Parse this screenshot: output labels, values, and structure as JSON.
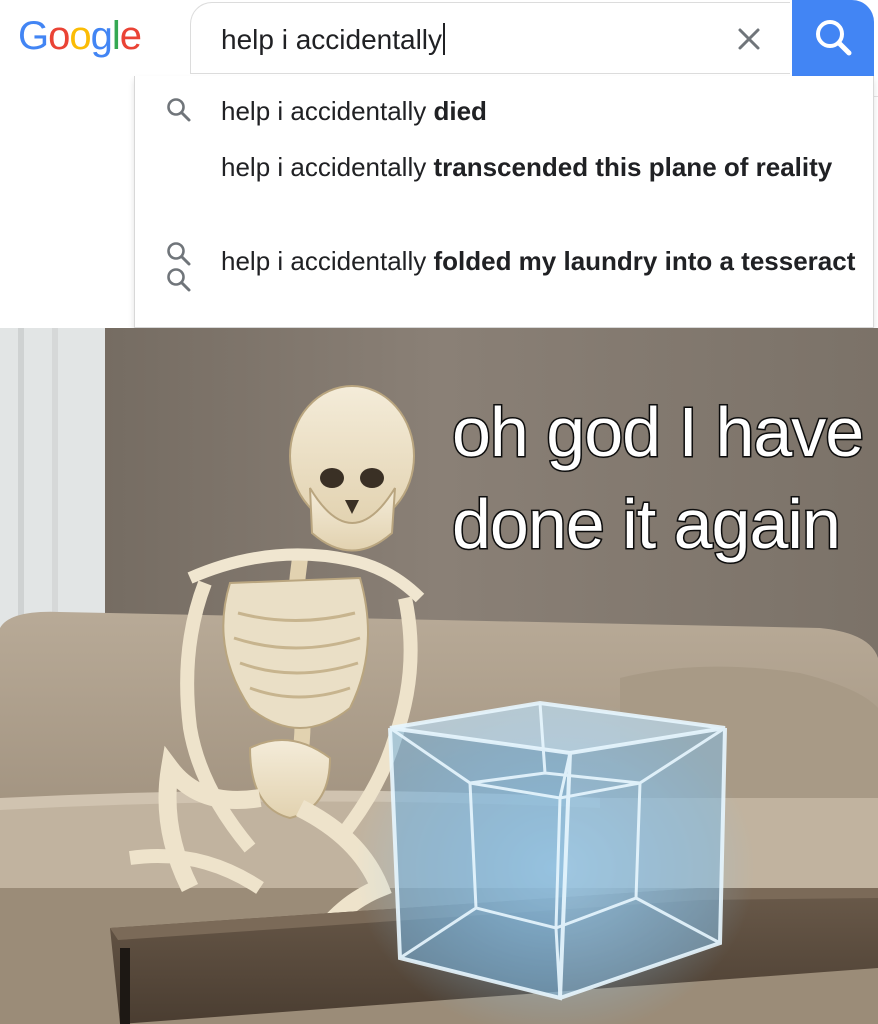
{
  "header": {
    "logo": {
      "letters": [
        "G",
        "o",
        "o",
        "g",
        "l",
        "e"
      ],
      "colors": [
        "#4285f4",
        "#ea4335",
        "#fbbc05",
        "#4285f4",
        "#34a853",
        "#ea4335"
      ]
    },
    "search": {
      "value": "help i accidentally"
    },
    "icons": {
      "clear": "close-icon",
      "search": "search-icon"
    },
    "accent": "#4285f4"
  },
  "suggestions": [
    {
      "prefix": "help i accidentally ",
      "bold": "died"
    },
    {
      "prefix": "help i accidentally ",
      "bold": "transcended this plane of reality"
    },
    {
      "prefix": "help i accidentally ",
      "bold": "folded my laundry into a tesseract"
    }
  ],
  "meme": {
    "caption": "oh god I have done it again",
    "subjects": [
      "skeleton",
      "sofa",
      "coffee-table",
      "glowing-tesseract"
    ]
  }
}
